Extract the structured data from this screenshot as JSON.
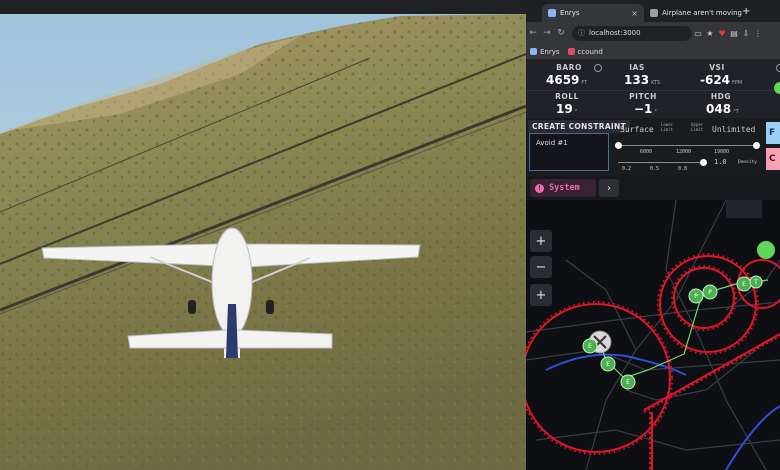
{
  "browser": {
    "tabs": [
      {
        "label": "Enrys",
        "active": true
      },
      {
        "label": "Airplane aren't moving",
        "active": false
      }
    ],
    "new_tab": "+",
    "url": "localhost:3000",
    "bookmarks": [
      {
        "label": "Enrys",
        "color": "#8ab4f8"
      },
      {
        "label": "ccound",
        "color": "#e34b6b"
      }
    ]
  },
  "instruments": {
    "baro": {
      "label": "BARO",
      "value": "4659",
      "unit": "FT"
    },
    "ias": {
      "label": "IAS",
      "value": "133",
      "unit": "KTS"
    },
    "vsi": {
      "label": "VSI",
      "value": "-624",
      "unit": "FPM"
    },
    "roll": {
      "label": "ROLL",
      "value": "19",
      "unit": "°"
    },
    "pitch": {
      "label": "PITCH",
      "value": "−1",
      "unit": "°"
    },
    "hdg": {
      "label": "HDG",
      "value": "048",
      "unit": "°T"
    }
  },
  "constraint": {
    "title": "CREATE CONSTRAINT",
    "name_value": "Avoid #1",
    "surface_label": "Surface",
    "lower_limit": "Lower Limit",
    "upper_limit": "Upper Limit",
    "unlimited_label": "Unlimited",
    "alt_ticks": [
      "6000",
      "12000",
      "19000"
    ],
    "density_value": "1.0",
    "density_label": "Density",
    "density_ticks": [
      "0.2",
      "0.5",
      "0.8"
    ],
    "button_f": "F",
    "button_c": "C"
  },
  "system": {
    "label": "System",
    "icon": "!",
    "next": "›"
  },
  "map": {
    "zoom_in": "+",
    "zoom_out": "−",
    "fit": "+",
    "waypoints": [
      "E",
      "E",
      "E",
      "P",
      "P",
      "E",
      "T"
    ]
  },
  "colors": {
    "accent": "#f06aa8",
    "constraint_red": "#e0142a",
    "waypoint_green": "#4caf50",
    "f_button": "#9ad0f5",
    "c_button": "#f7a1b5"
  }
}
